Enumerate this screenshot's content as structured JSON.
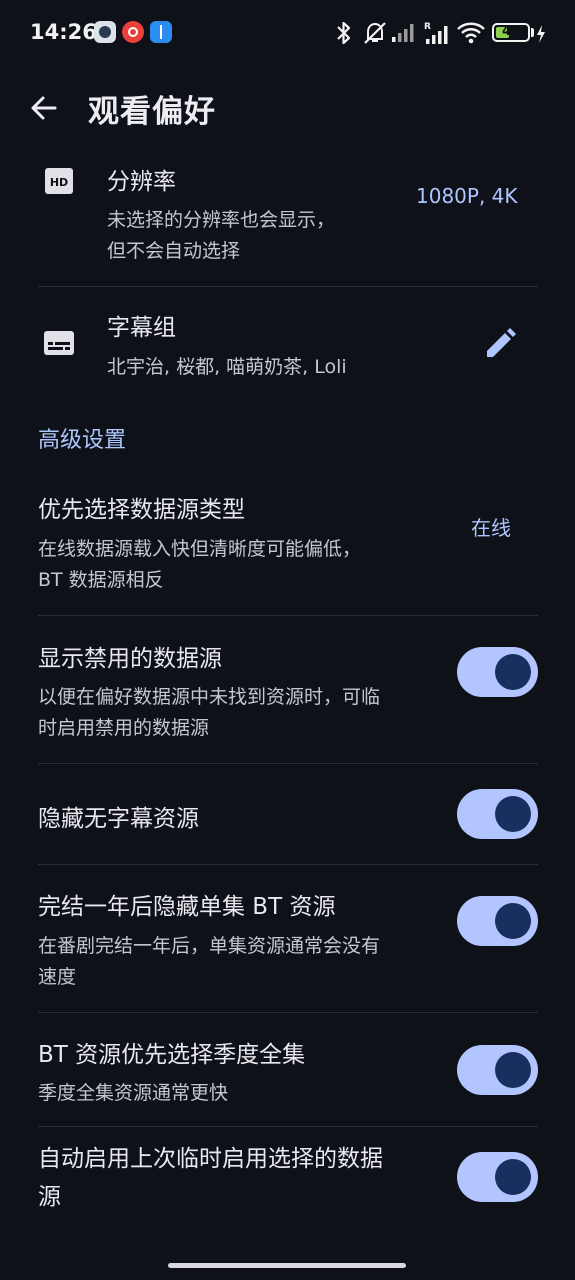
{
  "status_bar": {
    "time": "14:26",
    "battery_level": "42",
    "battery_fraction": 0.42,
    "icons": [
      "app-notification-icon",
      "netease-music-icon",
      "usb-icon",
      "bluetooth-icon",
      "silent-icon",
      "signal-icon",
      "signal-roaming-icon",
      "wifi-icon",
      "battery-icon",
      "charging-icon"
    ]
  },
  "header": {
    "title": "观看偏好",
    "back_icon": "arrow-left-icon"
  },
  "resolution": {
    "icon": "hd-icon",
    "title": "分辨率",
    "subtitle_line1": "未选择的分辨率也会显示，",
    "subtitle_line2": "但不会自动选择",
    "value": "1080P, 4K"
  },
  "subtitle_group": {
    "icon": "subtitles-icon",
    "title": "字幕组",
    "subtitle": "北宇治, 桜都, 喵萌奶茶, Loli",
    "action_icon": "pencil-icon"
  },
  "advanced": {
    "section_label": "高级设置",
    "source_type": {
      "title": "优先选择数据源类型",
      "subtitle_line1": "在线数据源载入快但清晰度可能偏低，",
      "subtitle_line2": "BT 数据源相反",
      "value": "在线"
    },
    "show_disabled": {
      "title": "显示禁用的数据源",
      "subtitle_line1": "以便在偏好数据源中未找到资源时，可临",
      "subtitle_line2": "时启用禁用的数据源",
      "enabled": true
    },
    "hide_no_sub": {
      "title": "隐藏无字幕资源",
      "enabled": true
    },
    "hide_single_bt": {
      "title": "完结一年后隐藏单集 BT 资源",
      "subtitle_line1": "在番剧完结一年后，单集资源通常会没有",
      "subtitle_line2": "速度",
      "enabled": true
    },
    "prefer_season_pack": {
      "title": "BT 资源优先选择季度全集",
      "subtitle": "季度全集资源通常更快",
      "enabled": true
    },
    "auto_enable_last": {
      "title_line1": "自动启用上次临时启用选择的数据",
      "title_line2": "源",
      "enabled": true
    }
  },
  "colors": {
    "background": "#0f1118",
    "accent": "#aec6ff",
    "switch_track": "#b3c5ff",
    "switch_thumb": "#18305f"
  }
}
